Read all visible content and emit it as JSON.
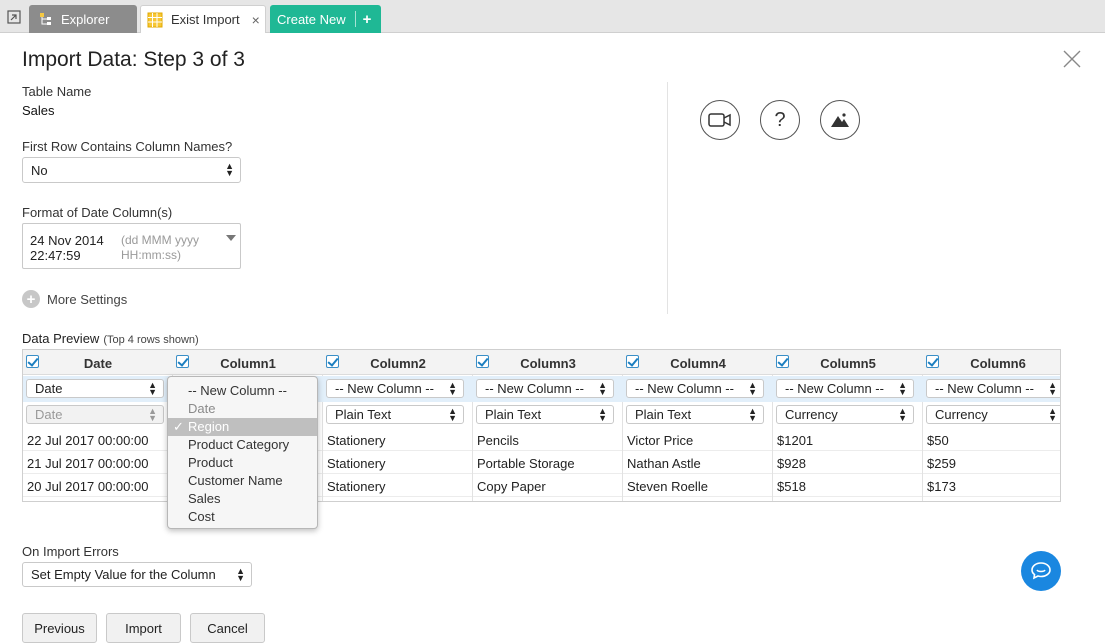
{
  "tabs": {
    "explorer": "Explorer",
    "exist_import": "Exist Import",
    "close": "×",
    "create_new": "Create New",
    "create_new_plus": "+"
  },
  "dialog": {
    "title": "Import Data: Step 3 of 3",
    "table_name_label": "Table Name",
    "table_name_value": "Sales",
    "first_row_label": "First Row Contains Column Names?",
    "first_row_value": "No",
    "date_format_label": "Format of Date Column(s)",
    "date_format_value": "24 Nov 2014 22:47:59",
    "date_format_hint": "(dd MMM yyyy HH:mm:ss)",
    "more_settings": "More Settings",
    "preview_title": "Data Preview",
    "preview_note": "(Top 4 rows shown)",
    "on_errors_label": "On Import Errors",
    "on_errors_value": "Set Empty Value for the Column"
  },
  "grid": {
    "columns": [
      {
        "header": "Date",
        "mapping": "Date",
        "type": "Date",
        "cells": [
          "22 Jul 2017 00:00:00",
          "21 Jul 2017 00:00:00",
          "20 Jul 2017 00:00:00"
        ]
      },
      {
        "header": "Column1",
        "mapping": "",
        "type": "",
        "cells": [
          "",
          "",
          ""
        ]
      },
      {
        "header": "Column2",
        "mapping": "-- New Column --",
        "type": "Plain Text",
        "cells": [
          "Stationery",
          "Stationery",
          "Stationery"
        ]
      },
      {
        "header": "Column3",
        "mapping": "-- New Column --",
        "type": "Plain Text",
        "cells": [
          "Pencils",
          "Portable Storage",
          "Copy Paper"
        ]
      },
      {
        "header": "Column4",
        "mapping": "-- New Column --",
        "type": "Plain Text",
        "cells": [
          "Victor Price",
          "Nathan Astle",
          "Steven Roelle"
        ]
      },
      {
        "header": "Column5",
        "mapping": "-- New Column --",
        "type": "Currency",
        "cells": [
          "$1201",
          "$928",
          "$518"
        ]
      },
      {
        "header": "Column6",
        "mapping": "-- New Column --",
        "type": "Currency",
        "cells": [
          "$50",
          "$259",
          "$173"
        ]
      }
    ]
  },
  "dropdown": {
    "items": [
      "-- New Column --",
      "Date",
      "Region",
      "Product Category",
      "Product",
      "Customer Name",
      "Sales",
      "Cost"
    ],
    "selected": "Region",
    "check": "✓"
  },
  "buttons": {
    "previous": "Previous",
    "import": "Import",
    "cancel": "Cancel"
  },
  "colors": {
    "accent_green": "#1fb895",
    "chat_blue": "#1a87e0",
    "mapping_band": "#e2effa"
  }
}
